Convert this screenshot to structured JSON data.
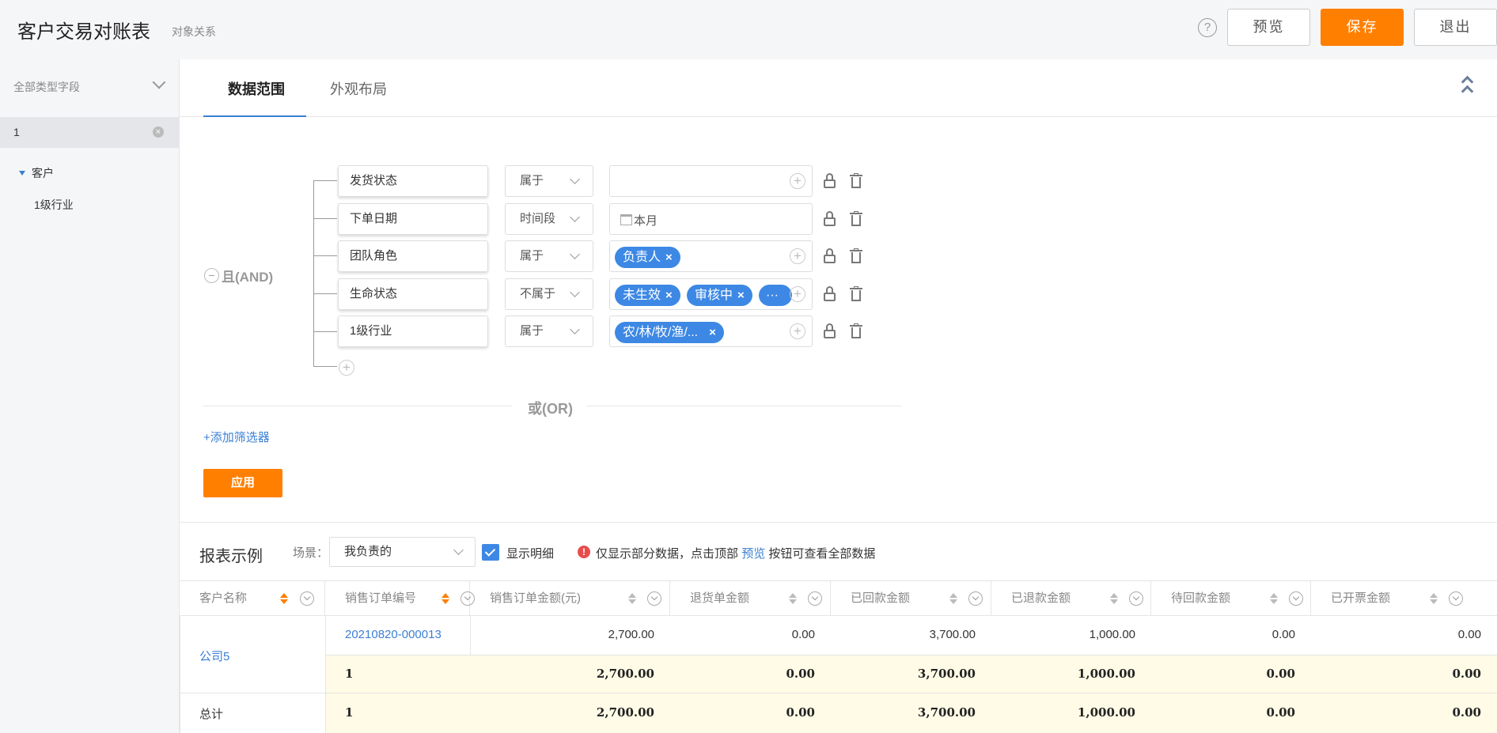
{
  "header": {
    "title": "客户交易对账表",
    "subtitle": "对象关系",
    "help_icon": "?",
    "preview_label": "预览",
    "save_label": "保存",
    "exit_label": "退出"
  },
  "colors": {
    "accent": "#ff7f00",
    "primary": "#3d88e4",
    "link": "#3b7fd4"
  },
  "sidebar": {
    "type_select": "全部类型字段",
    "search_value": "1",
    "tree": {
      "parent": "客户",
      "child": "1级行业"
    }
  },
  "tabs": [
    {
      "label": "数据范围",
      "active": true
    },
    {
      "label": "外观布局",
      "active": false
    }
  ],
  "filter": {
    "and_label": "且(AND)",
    "conditions": [
      {
        "field": "发货状态",
        "op": "属于",
        "tags": []
      },
      {
        "field": "下单日期",
        "op": "时间段",
        "date": "本月"
      },
      {
        "field": "团队角色",
        "op": "属于",
        "tags": [
          "负责人"
        ]
      },
      {
        "field": "生命状态",
        "op": "不属于",
        "tags": [
          "未生效",
          "审核中",
          "···"
        ]
      },
      {
        "field": "1级行业",
        "op": "属于",
        "tags": [
          "农/林/牧/渔/..."
        ]
      }
    ],
    "or_label": "或(OR)",
    "add_filter": "+添加筛选器",
    "apply_label": "应用"
  },
  "report": {
    "title": "报表示例",
    "scene_label": "场景：",
    "scene_value": "我负责的",
    "show_detail": "显示明细",
    "warn_before": "仅显示部分数据，点击顶部",
    "warn_link": "预览",
    "warn_after": "按钮可查看全部数据",
    "columns": [
      "客户名称",
      "销售订单编号",
      "销售订单金额(元)",
      "退货单金额",
      "已回款金额",
      "已退款金额",
      "待回款金额",
      "已开票金额"
    ],
    "rows": {
      "customer": "公司5",
      "order_no": "20210820-000013",
      "detail": [
        "2,700.00",
        "0.00",
        "3,700.00",
        "1,000.00",
        "0.00",
        "0.00"
      ],
      "subtotal_count": "1",
      "subtotal": [
        "2,700.00",
        "0.00",
        "3,700.00",
        "1,000.00",
        "0.00",
        "0.00"
      ],
      "total_label": "总计",
      "total_count": "1",
      "total": [
        "2,700.00",
        "0.00",
        "3,700.00",
        "1,000.00",
        "0.00",
        "0.00"
      ]
    }
  }
}
